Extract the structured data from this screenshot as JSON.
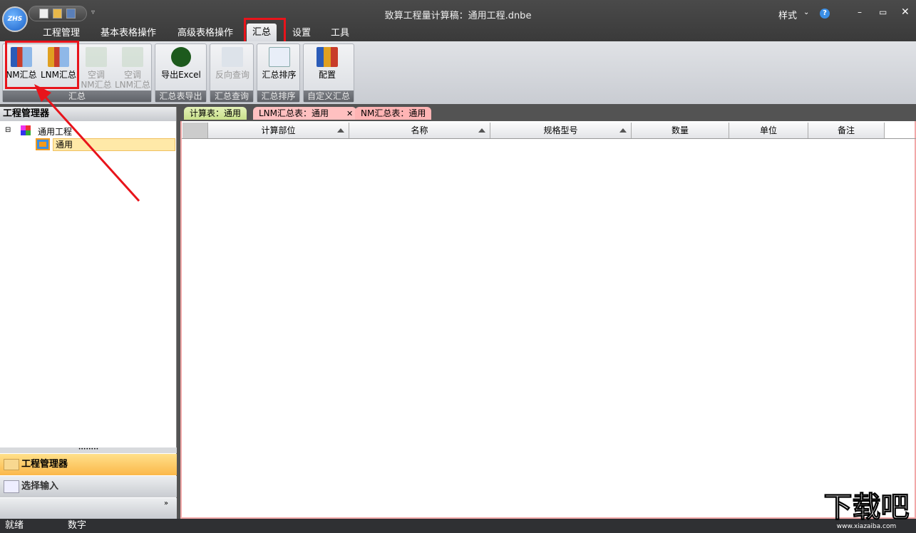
{
  "app": {
    "logo_text": "ZHS",
    "title": "致算工程量计算稿：通用工程.dnbe",
    "style_menu": "样式",
    "help_icon": "help-icon"
  },
  "quick_access": [
    "new-file-icon",
    "open-folder-icon",
    "save-icon"
  ],
  "tabs": [
    {
      "label": "工程管理"
    },
    {
      "label": "基本表格操作"
    },
    {
      "label": "高级表格操作"
    },
    {
      "label": "汇总"
    },
    {
      "label": "设置"
    },
    {
      "label": "工具"
    }
  ],
  "ribbon": {
    "groups": [
      {
        "label": "汇总",
        "buttons": [
          {
            "label": "NM汇总"
          },
          {
            "label": "LNM汇总"
          },
          {
            "label": "空调\nNM汇总"
          },
          {
            "label": "空调\nLNM汇总"
          }
        ]
      },
      {
        "label": "汇总表导出",
        "buttons": [
          {
            "label": "导出Excel"
          }
        ]
      },
      {
        "label": "汇总查询",
        "buttons": [
          {
            "label": "反向查询"
          }
        ]
      },
      {
        "label": "汇总排序",
        "buttons": [
          {
            "label": "汇总排序"
          }
        ]
      },
      {
        "label": "自定义汇总",
        "buttons": [
          {
            "label": "配置"
          }
        ]
      }
    ]
  },
  "left_panel": {
    "title": "工程管理器",
    "tree": {
      "root": "通用工程",
      "child": "通用"
    },
    "nav": [
      {
        "label": "工程管理器"
      },
      {
        "label": "选择输入"
      }
    ]
  },
  "doc_tabs": [
    {
      "label": "计算表：通用"
    },
    {
      "label": "LNM汇总表：通用"
    },
    {
      "label": "NM汇总表：通用"
    }
  ],
  "table": {
    "columns": [
      "计算部位",
      "名称",
      "规格型号",
      "数量",
      "单位",
      "备注"
    ]
  },
  "status": {
    "ready": "就绪",
    "mode": "数字"
  },
  "watermark": {
    "text": "下载吧",
    "url": "www.xiazaiba.com"
  },
  "colors": {
    "highlight": "#e8141b",
    "active_nav": "#fbb84a"
  }
}
